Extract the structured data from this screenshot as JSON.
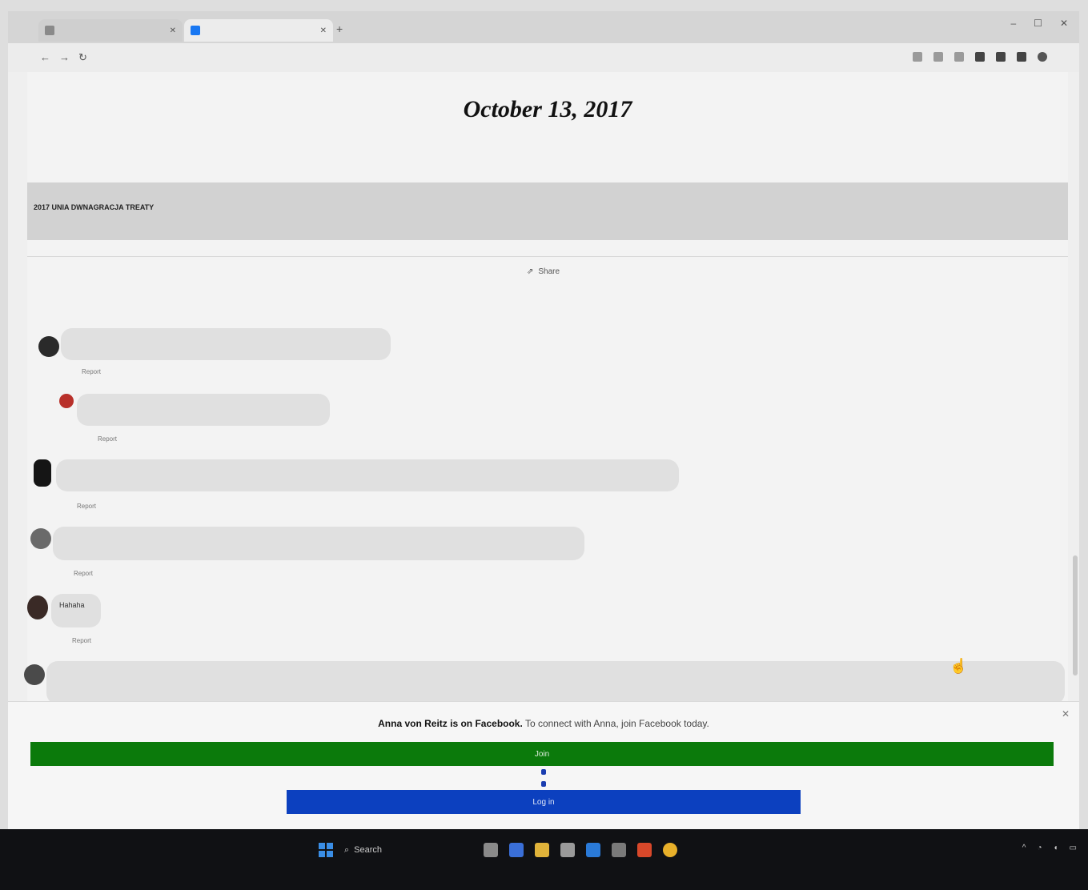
{
  "browser": {
    "tabs": [
      {
        "title": "",
        "active": false,
        "favicon_color": "#8a8a8a"
      },
      {
        "title": "",
        "active": true,
        "favicon_color": "#1877f2"
      }
    ],
    "new_tab_label": "+",
    "url": "",
    "window_controls": [
      "–",
      "☐",
      "✕"
    ]
  },
  "post": {
    "date": "October 13, 2017",
    "link_domain": "",
    "link_title": "2017 UNIA DWNAGRACJA TREATY",
    "link_description": "",
    "share_label": "Share",
    "shares_count": ""
  },
  "comments": [
    {
      "author": "",
      "text": "",
      "actions": [
        "",
        "Report"
      ]
    },
    {
      "author": "",
      "text": "",
      "actions": [
        "",
        "Report"
      ]
    },
    {
      "author": "",
      "text": "",
      "actions": [
        "",
        "Report"
      ]
    },
    {
      "author": "",
      "text": "",
      "actions": [
        "",
        "Report"
      ]
    },
    {
      "author": "",
      "text": "Hahaha",
      "actions": [
        "",
        "Report"
      ]
    },
    {
      "author": "",
      "text": "",
      "actions": []
    }
  ],
  "login_prompt": {
    "name": "Anna von Reitz is on Facebook.",
    "message": "To connect with Anna, join Facebook today.",
    "join_label": "Join",
    "login_label": "Log in",
    "join_color": "#0b7a0b",
    "login_color": "#0c40bf"
  },
  "taskbar": {
    "search_placeholder": "Search",
    "icons": [
      "windows-start-icon",
      "search-icon",
      "file-explorer-icon",
      "store-icon",
      "folder-icon",
      "app-icon",
      "app-icon",
      "app-icon",
      "app-icon",
      "chrome-icon"
    ],
    "tray_items": [
      "^",
      "",
      "",
      ""
    ]
  },
  "colors": {
    "facebook_blue": "#1877f2"
  }
}
